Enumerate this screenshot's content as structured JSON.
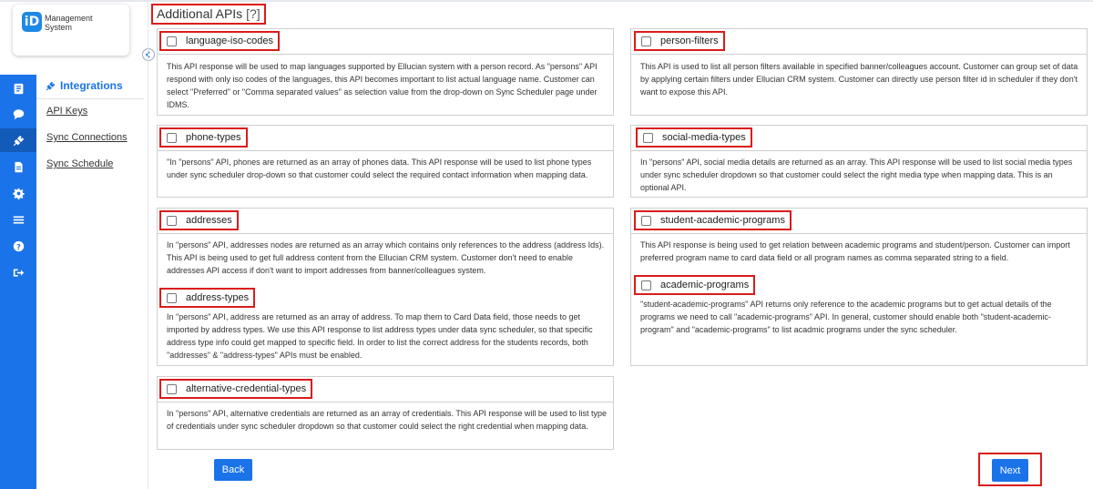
{
  "logo": {
    "mark": "iD",
    "line1": "Management",
    "line2": "System"
  },
  "rail": {
    "icons": [
      "profile-card-icon",
      "chat-icon",
      "plug-icon",
      "document-icon",
      "gear-icon",
      "list-icon",
      "help-icon",
      "logout-icon"
    ],
    "active_index": 2
  },
  "subnav": {
    "title": "Integrations",
    "links": [
      "API Keys",
      "Sync Connections",
      "Sync Schedule"
    ]
  },
  "heading": {
    "title": "Additional APIs",
    "help": "[?]"
  },
  "apis": {
    "language_iso_codes": {
      "label": "language-iso-codes",
      "description": "This API response will be used to map languages supported by Ellucian system with a person record. As \"persons\" API respond with only iso codes of the languages, this API becomes important to list actual language name. Customer can select \"Preferred\" or \"Comma separated values\" as selection value from the drop-down on Sync Scheduler page under IDMS."
    },
    "person_filters": {
      "label": "person-filters",
      "description": "This API is used to list all person filters available in specified banner/colleagues account. Customer can group set of data by applying certain filters under Ellucian CRM system. Customer can directly use person filter id in scheduler if they don't want to expose this API."
    },
    "phone_types": {
      "label": "phone-types",
      "description": "\"In \"persons\" API, phones are returned as an array of phones data. This API response will be used to list phone types under sync scheduler drop-down so that customer could select the required contact information when mapping data."
    },
    "social_media_types": {
      "label": "social-media-types",
      "description": "In \"persons\" API, social media details are returned as an array. This API response will be used to list social media types under sync scheduler dropdown so that customer could select the right media type when mapping data. This is an optional API."
    },
    "addresses": {
      "label": "addresses",
      "description": "In \"persons\" API, addresses nodes are returned as an array which contains only references to the address (address Ids). This API is being used to get full address content from the Ellucian CRM system. Customer don't need to enable addresses API access if don't want to import addresses from banner/colleagues system."
    },
    "address_types": {
      "label": "address-types",
      "description": "In \"persons\" API, address are returned as an array of address. To map them to Card Data field, those needs to get imported by address types. We use this API response to list address types under data sync scheduler, so that specific address type info could get mapped to specific field. In order to list the correct address for the students records, both \"addresses\" & \"address-types\" APIs must be enabled."
    },
    "student_academic_programs": {
      "label": "student-academic-programs",
      "description": "This API response is being used to get relation between academic programs and student/person. Customer can import preferred program name to card data field or all program names as comma separated string to a field."
    },
    "academic_programs": {
      "label": "academic-programs",
      "description": "\"student-academic-programs\" API returns only reference to the academic programs but to get actual details of the programs we need to call \"academic-programs\" API. In general, customer should enable both \"student-academic-program\" and \"academic-programs\" to list acadmic programs under the sync scheduler."
    },
    "alternative_credential_types": {
      "label": "alternative-credential-types",
      "description": "In \"persons\" API, alternative credentials are returned as an array of credentials. This API response will be used to list type of credentials under sync scheduler dropdown so that customer could select the right credential when mapping data."
    }
  },
  "buttons": {
    "back": "Back",
    "next": "Next"
  },
  "colors": {
    "accent": "#1a73e8",
    "highlight": "#d91c1c"
  }
}
